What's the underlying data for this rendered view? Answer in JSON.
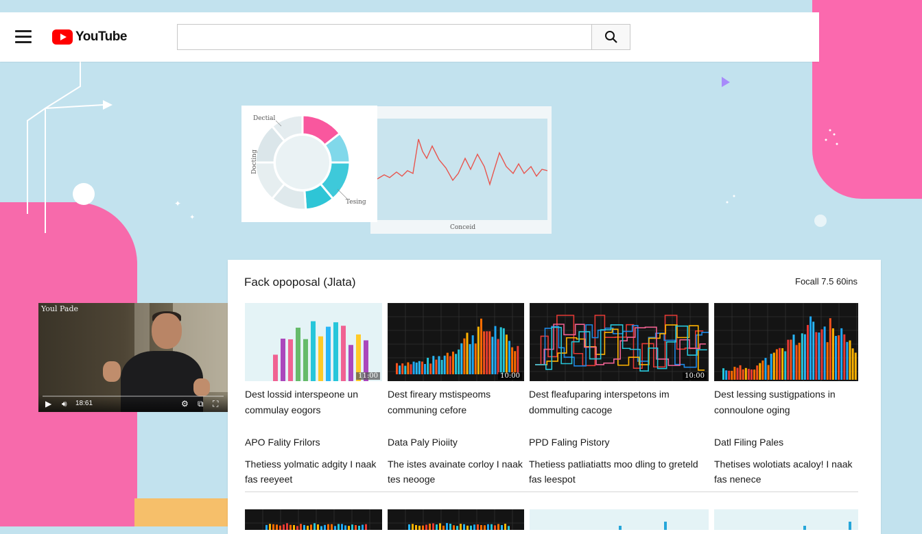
{
  "header": {
    "logo_text": "YouTube",
    "search": {
      "value": "",
      "placeholder": ""
    }
  },
  "chart_panel": {
    "donut": {
      "label_top": "Dectial",
      "label_left": "Docting",
      "label_bottom": "Tesing",
      "segments": [
        {
          "color": "#f9579e",
          "highlighted": true
        },
        {
          "color": "#80d8ea",
          "highlighted": true
        },
        {
          "color": "#3ec9da",
          "highlighted": true
        },
        {
          "color": "#2ec5d6",
          "highlighted": true
        }
      ]
    },
    "line": {
      "color": "#e8554e",
      "xlabel": "Conceid"
    }
  },
  "video_player": {
    "title": "Youl Pade",
    "time": "18:61",
    "progress": 0.0
  },
  "feed": {
    "title": "Fack opoposal (Jlata)",
    "meta": "Focall 7.5 60ins",
    "videos": [
      {
        "duration": "11:00",
        "title_line1": "Dest lossid interspeone un",
        "title_line2": "commulay eogors"
      },
      {
        "duration": "10:00",
        "title_line1": "Dest fireary mstispeoms",
        "title_line2": "communing cefore"
      },
      {
        "duration": "10:00",
        "title_line1": "Dest fleafuparing interspetons im",
        "title_line2": "dommulting cacoge"
      },
      {
        "duration": "",
        "title_line1": "Dest lessing sustigpations in",
        "title_line2": "connoulone oging"
      }
    ],
    "playlists": [
      {
        "title": "APO Fality Frilors",
        "desc_line1": "Thetiess yolmatic adgity I naak",
        "desc_line2": "fas reeyeet"
      },
      {
        "title": "Data Paly Pioiity",
        "desc_line1": "The istes avainate corloy I naak",
        "desc_line2": "tes neooge"
      },
      {
        "title": "PPD Faling Pistory",
        "desc_line1": "Thetiess patliatiatts moo dling to greteld",
        "desc_line2": "fas leespot"
      },
      {
        "title": "Datl Filing Pales",
        "desc_line1": "Thetises wolotiats acaloy! I naak",
        "desc_line2": "fas nenece"
      }
    ]
  },
  "colors": {
    "brand_red": "#ff0000",
    "background": "#c2e2ee",
    "blob_pink": "#fb69ae",
    "accent_yellow": "#f6bf6a"
  },
  "icons": [
    "hamburger-icon",
    "youtube-logo-icon",
    "search-icon",
    "play-icon",
    "volume-icon",
    "settings-icon",
    "miniplayer-icon",
    "fullscreen-icon"
  ]
}
